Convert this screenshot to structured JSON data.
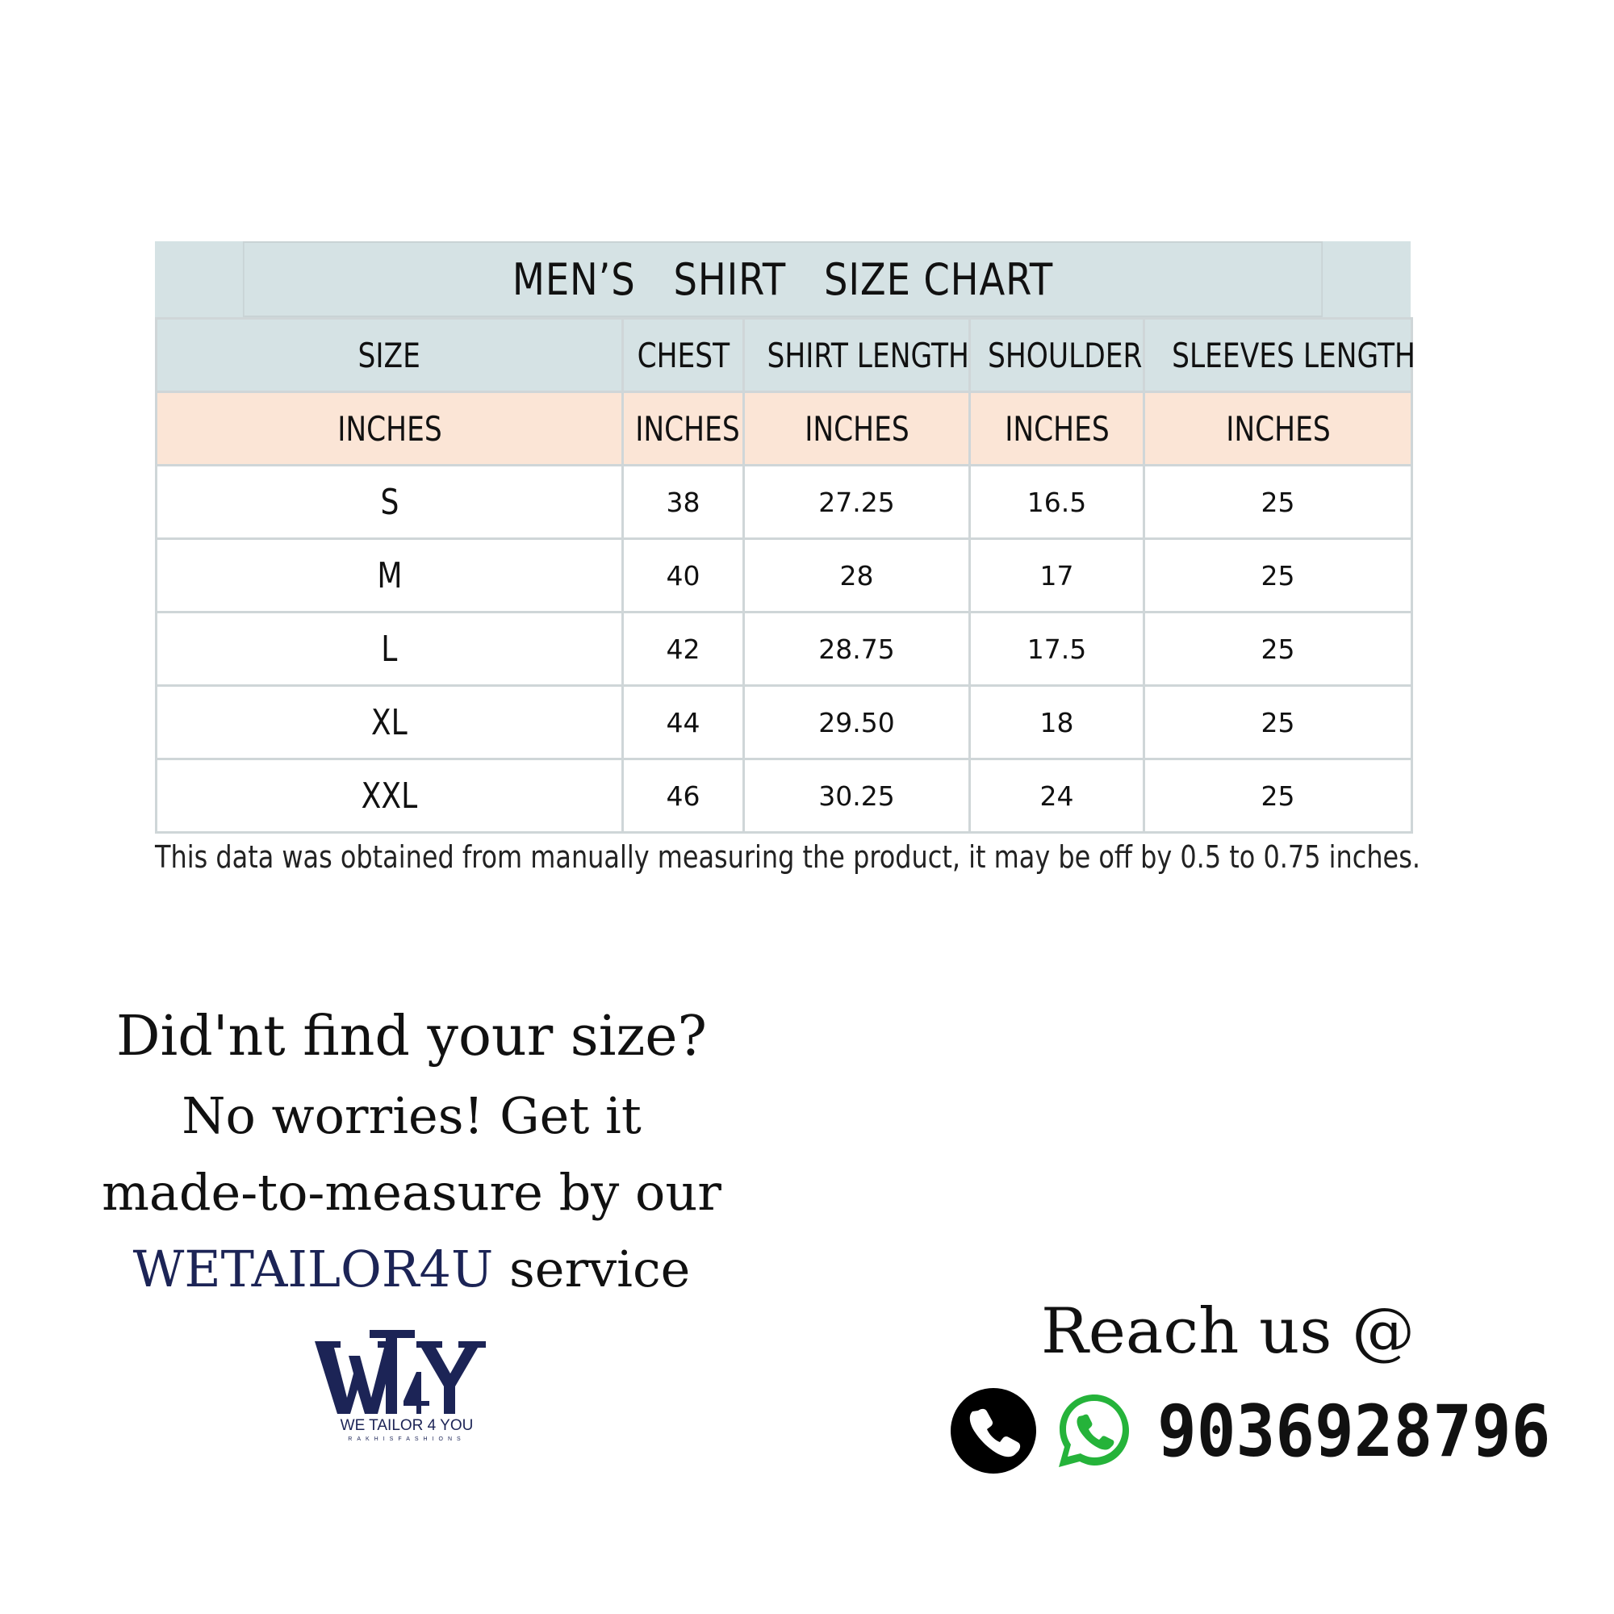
{
  "size_chart": {
    "title": "MEN’S   SHIRT   SIZE CHART",
    "headers": [
      "SIZE",
      "CHEST",
      "SHIRT LENGTH",
      "SHOULDER",
      "SLEEVES LENGTH"
    ],
    "units": [
      "INCHES",
      "INCHES",
      "INCHES",
      "INCHES",
      "INCHES"
    ],
    "rows": [
      {
        "size": "S",
        "chest": "38",
        "shirt_length": "27.25",
        "shoulder": "16.5",
        "sleeves_length": "25"
      },
      {
        "size": "M",
        "chest": "40",
        "shirt_length": "28",
        "shoulder": "17",
        "sleeves_length": "25"
      },
      {
        "size": "L",
        "chest": "42",
        "shirt_length": "28.75",
        "shoulder": "17.5",
        "sleeves_length": "25"
      },
      {
        "size": "XL",
        "chest": "44",
        "shirt_length": "29.50",
        "shoulder": "18",
        "sleeves_length": "25"
      },
      {
        "size": "XXL",
        "chest": "46",
        "shirt_length": "30.25",
        "shoulder": "24",
        "sleeves_length": "25"
      }
    ],
    "footnote": "This data was obtained from manually measuring the product, it may be off by 0.5 to 0.75 inches."
  },
  "promo": {
    "line1": "Did'nt find your size?",
    "line2": "No worries! Get it",
    "line3": "made-to-measure by our",
    "brand": "WETAILOR4U",
    "line4_suffix": " service"
  },
  "logo": {
    "mark": "WT4Y",
    "name": "WE TAILOR 4 YOU",
    "sub": "RAKHISFASHIONS"
  },
  "contact": {
    "reach_label": "Reach us @",
    "phone": "9036928796",
    "icons": [
      "phone-icon",
      "whatsapp-icon"
    ]
  },
  "colors": {
    "header_bg": "#d5e2e4",
    "unit_row_bg": "#fbe5d6",
    "brand_navy": "#1c2456",
    "whatsapp_green": "#25b33a"
  }
}
